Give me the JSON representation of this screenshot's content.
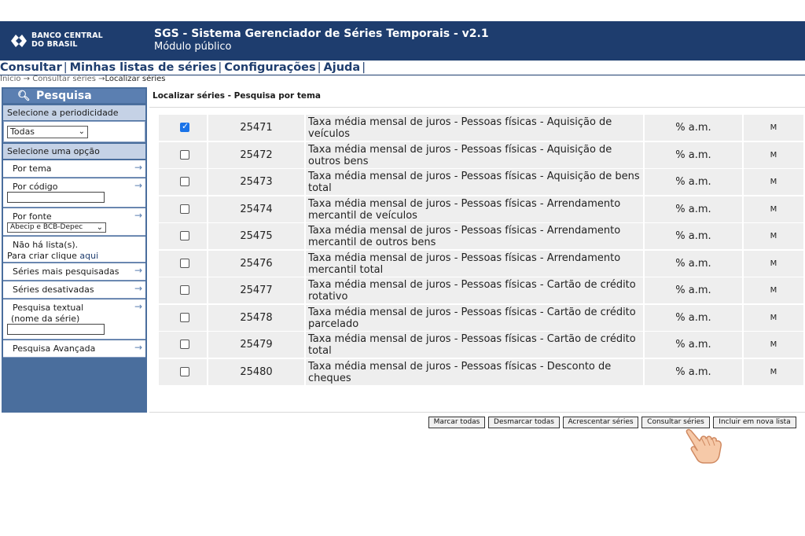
{
  "header": {
    "logo_line1": "BANCO CENTRAL",
    "logo_line2": "DO BRASIL",
    "title": "SGS - Sistema Gerenciador de Séries Temporais - v2.1",
    "subtitle": "Módulo público"
  },
  "menu": [
    {
      "label": "Consultar"
    },
    {
      "label": "Minhas listas de séries"
    },
    {
      "label": "Configurações"
    },
    {
      "label": "Ajuda"
    }
  ],
  "breadcrumb": {
    "items": [
      "Início",
      "Consultar séries",
      "Localizar séries"
    ],
    "separator": "→"
  },
  "sidebar": {
    "header": "Pesquisa",
    "periodicity_label": "Selecione a periodicidade",
    "periodicity_value": "Todas",
    "option_label": "Selecione uma opção",
    "por_tema": "Por tema",
    "por_codigo": "Por código",
    "por_fonte": "Por fonte",
    "fonte_value": "Abecip e BCB-Depec",
    "no_lists_line1": "Não há lista(s).",
    "no_lists_line2": "Para criar clique ",
    "no_lists_link": "aqui",
    "mais_pesquisadas": "Séries mais pesquisadas",
    "desativadas": "Séries desativadas",
    "textual_line1": "Pesquisa textual",
    "textual_line2": "(nome da série)",
    "avancada": "Pesquisa Avançada"
  },
  "main": {
    "title": "Localizar séries - Pesquisa por tema",
    "rows": [
      {
        "checked": true,
        "code": "25471",
        "name": "Taxa média mensal de juros - Pessoas físicas - Aquisição de veículos",
        "unit": "% a.m.",
        "periodicity": "M"
      },
      {
        "checked": false,
        "code": "25472",
        "name": "Taxa média mensal de juros - Pessoas físicas - Aquisição de outros bens",
        "unit": "% a.m.",
        "periodicity": "M"
      },
      {
        "checked": false,
        "code": "25473",
        "name": "Taxa média mensal de juros - Pessoas físicas - Aquisição de bens total",
        "unit": "% a.m.",
        "periodicity": "M"
      },
      {
        "checked": false,
        "code": "25474",
        "name": "Taxa média mensal de juros - Pessoas físicas - Arrendamento mercantil de veículos",
        "unit": "% a.m.",
        "periodicity": "M"
      },
      {
        "checked": false,
        "code": "25475",
        "name": "Taxa média mensal de juros - Pessoas físicas - Arrendamento mercantil de outros bens",
        "unit": "% a.m.",
        "periodicity": "M"
      },
      {
        "checked": false,
        "code": "25476",
        "name": "Taxa média mensal de juros - Pessoas físicas - Arrendamento mercantil total",
        "unit": "% a.m.",
        "periodicity": "M"
      },
      {
        "checked": false,
        "code": "25477",
        "name": "Taxa média mensal de juros - Pessoas físicas - Cartão de crédito rotativo",
        "unit": "% a.m.",
        "periodicity": "M"
      },
      {
        "checked": false,
        "code": "25478",
        "name": "Taxa média mensal de juros - Pessoas físicas - Cartão de crédito parcelado",
        "unit": "% a.m.",
        "periodicity": "M"
      },
      {
        "checked": false,
        "code": "25479",
        "name": "Taxa média mensal de juros - Pessoas físicas - Cartão de crédito total",
        "unit": "% a.m.",
        "periodicity": "M"
      },
      {
        "checked": false,
        "code": "25480",
        "name": "Taxa média mensal de juros - Pessoas físicas - Desconto de cheques",
        "unit": "% a.m.",
        "periodicity": "M"
      }
    ]
  },
  "buttons": {
    "marcar": "Marcar todas",
    "desmarcar": "Desmarcar todas",
    "acrescentar": "Acrescentar séries",
    "consultar": "Consultar séries",
    "incluir": "Incluir em nova lista"
  },
  "icons": {
    "search": "search-icon",
    "arrow": "arrow-right-icon",
    "pointer": "pointing-hand-icon"
  },
  "colors": {
    "header_bg": "#1e3d6e",
    "sidebar_bg": "#4a6e9d",
    "sidebar_label_bg": "#c5d2e6",
    "row_bg": "#eeeeee",
    "checkbox_on": "#1a73e8"
  }
}
